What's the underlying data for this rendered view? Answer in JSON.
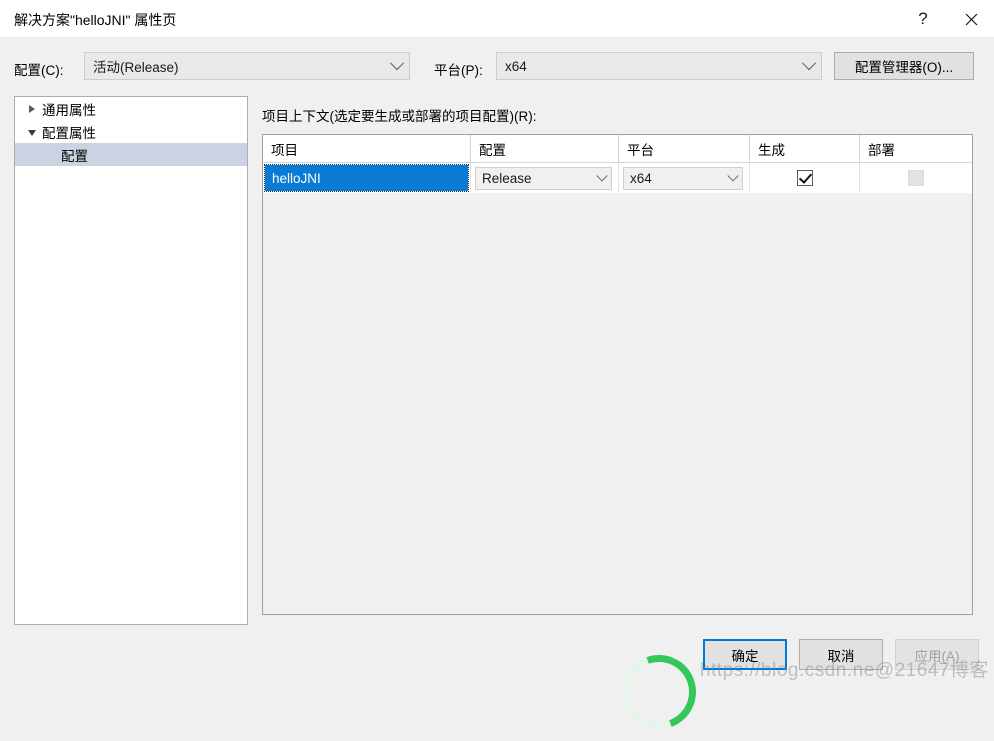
{
  "window": {
    "title": "解决方案\"helloJNI\" 属性页",
    "help_label": "?",
    "close_label": "✕"
  },
  "config_bar": {
    "configuration_label": "配置(C):",
    "configuration_value": "活动(Release)",
    "platform_label": "平台(P):",
    "platform_value": "x64",
    "config_manager_button": "配置管理器(O)..."
  },
  "tree": {
    "items": [
      {
        "label": "通用属性",
        "level": 1,
        "expanded": false,
        "selected": false
      },
      {
        "label": "配置属性",
        "level": 1,
        "expanded": true,
        "selected": false
      },
      {
        "label": "配置",
        "level": 2,
        "expanded": null,
        "selected": true
      }
    ]
  },
  "content": {
    "context_label": "项目上下文(选定要生成或部署的项目配置)(R):",
    "columns": [
      "项目",
      "配置",
      "平台",
      "生成",
      "部署"
    ],
    "rows": [
      {
        "project": "helloJNI",
        "configuration": "Release",
        "platform": "x64",
        "build_checked": true,
        "deploy_checked": false,
        "deploy_disabled": true,
        "selected": true
      }
    ]
  },
  "footer": {
    "ok_label": "确定",
    "cancel_label": "取消",
    "apply_label": "应用(A)"
  },
  "overlay": {
    "watermark": "https://blog.csdn.ne@21647博客"
  },
  "colors": {
    "accent": "#0078D7",
    "row_selection": "#0A7BD4",
    "tree_selection": "#CBD2E1",
    "dialog_background": "#F0F0F0",
    "spinner_green": "#34C759"
  }
}
